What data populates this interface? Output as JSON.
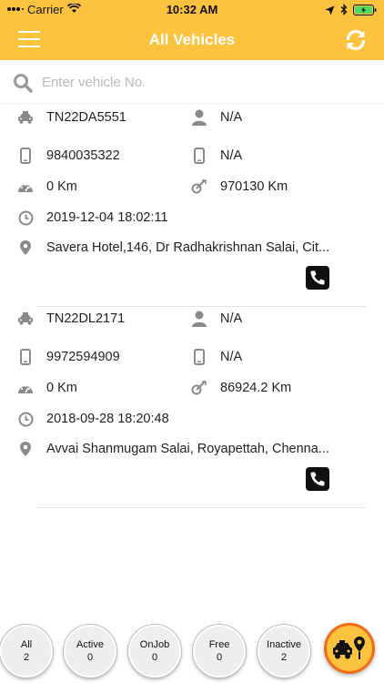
{
  "status_bar": {
    "carrier": "Carrier",
    "time": "10:32 AM"
  },
  "header": {
    "title": "All Vehicles"
  },
  "search": {
    "placeholder": "Enter vehicle No."
  },
  "vehicles": [
    {
      "number": "TN22DA5551",
      "driver": "N/A",
      "phone": "9840035322",
      "alt_phone": "N/A",
      "speed": "0 Km",
      "odometer": "970130 Km",
      "timestamp": "2019-12-04 18:02:11",
      "address": "Savera Hotel,146, Dr Radhakrishnan Salai, Cit..."
    },
    {
      "number": "TN22DL2171",
      "driver": "N/A",
      "phone": "9972594909",
      "alt_phone": "N/A",
      "speed": "0 Km",
      "odometer": "86924.2 Km",
      "timestamp": "2018-09-28 18:20:48",
      "address": "Avvai Shanmugam Salai, Royapettah, Chenna..."
    }
  ],
  "filters": [
    {
      "label": "All",
      "count": "2"
    },
    {
      "label": "Active",
      "count": "0"
    },
    {
      "label": "OnJob",
      "count": "0"
    },
    {
      "label": "Free",
      "count": "0"
    },
    {
      "label": "Inactive",
      "count": "2"
    }
  ],
  "colors": {
    "accent": "#FDC33E",
    "fab_border": "#F26C17"
  },
  "icons": {
    "menu": "hamburger-icon",
    "refresh": "refresh-icon",
    "search": "search-icon",
    "vehicle": "taxi-icon",
    "driver": "person-icon",
    "phone": "mobile-phone-icon",
    "speed": "speedometer-icon",
    "odometer": "odometer-icon",
    "time": "clock-icon",
    "location": "location-pin-icon",
    "call": "call-icon",
    "fab": "taxi-location-icon"
  }
}
